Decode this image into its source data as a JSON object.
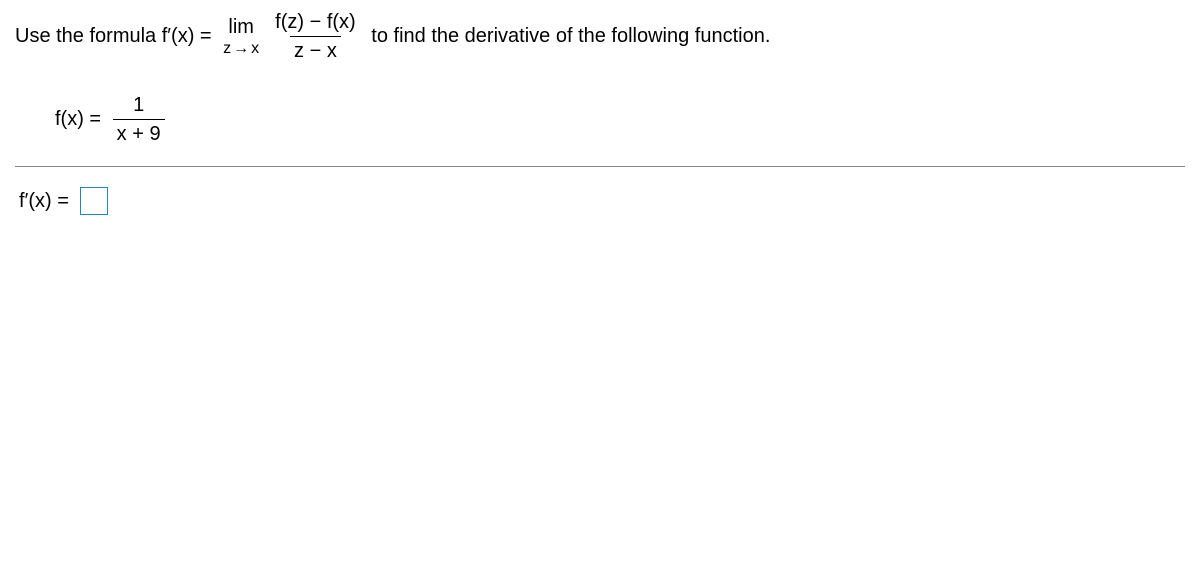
{
  "statement": {
    "before_formula": "Use the formula f",
    "prime1": "′",
    "open_paren": "(x) = ",
    "lim_text": "lim",
    "lim_var1": "z",
    "lim_arrow": "→",
    "lim_var2": "x",
    "frac_num": "f(z) − f(x)",
    "frac_den": "z − x",
    "after_formula": " to find the derivative of the following function."
  },
  "given": {
    "lhs": "f(x) = ",
    "frac_num": "1",
    "frac_den": "x + 9"
  },
  "answer": {
    "lhs_f": "f",
    "prime": "′",
    "lhs_rest": "(x) = ",
    "value": ""
  }
}
